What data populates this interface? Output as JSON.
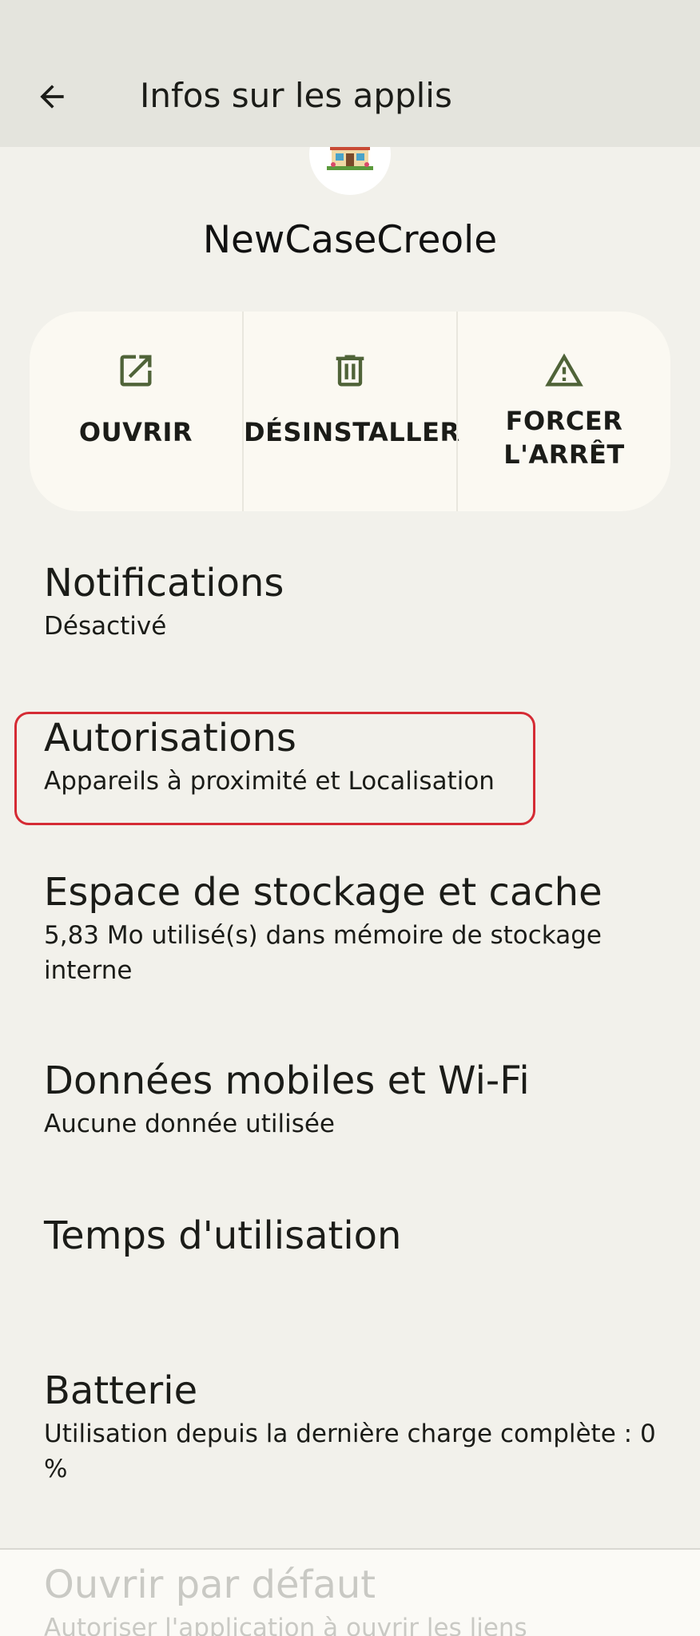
{
  "appbar": {
    "title": "Infos sur les applis",
    "back_icon": "arrow-left-icon"
  },
  "app": {
    "name": "NewCaseCreole",
    "icon": "house-storefront-icon"
  },
  "actions": [
    {
      "label": "OUVRIR",
      "icon": "open-in-new-icon"
    },
    {
      "label": "DÉSINSTALLER",
      "icon": "trash-icon"
    },
    {
      "label_line1": "FORCER",
      "label_line2": "L'ARRÊT",
      "icon": "warning-triangle-icon"
    }
  ],
  "settings": [
    {
      "title": "Notifications",
      "summary": "Désactivé"
    },
    {
      "title": "Autorisations",
      "summary": "Appareils à proximité et Localisation"
    },
    {
      "title": "Espace de stockage et cache",
      "summary": "5,83 Mo utilisé(s) dans mémoire de stockage interne"
    },
    {
      "title": "Données mobiles et Wi-Fi",
      "summary": "Aucune donnée utilisée"
    },
    {
      "title": "Temps d'utilisation",
      "summary": ""
    },
    {
      "title": "Batterie",
      "summary": "Utilisation depuis la dernière charge complète : 0 %"
    },
    {
      "title": "Ouvrir par défaut",
      "summary": "Autoriser l'application à ouvrir les liens"
    }
  ],
  "colors": {
    "accent_icon": "#4f6338",
    "highlight": "#d52b34",
    "background": "#f2f1eb",
    "appbar": "#e4e4dd"
  }
}
